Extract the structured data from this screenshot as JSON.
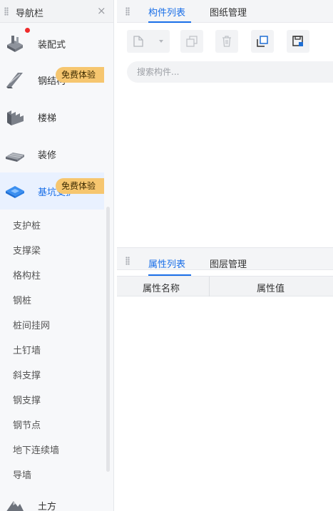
{
  "nav": {
    "title": "导航栏",
    "close": "×",
    "categories": [
      {
        "label": "装配式",
        "icon": "prefab-component-icon",
        "has_dot": true
      },
      {
        "label": "钢结构",
        "icon": "steel-beam-icon",
        "badge": "免费体验"
      },
      {
        "label": "楼梯",
        "icon": "stairs-icon"
      },
      {
        "label": "装修",
        "icon": "decoration-floor-icon"
      },
      {
        "label": "基坑支护",
        "icon": "foundation-pit-icon",
        "badge": "免费体验",
        "active": true
      }
    ],
    "sub_items": [
      "支护桩",
      "支撑梁",
      "格构柱",
      "钢桩",
      "桩间挂网",
      "土钉墙",
      "斜支撑",
      "钢支撑",
      "钢节点",
      "地下连续墙",
      "导墙"
    ],
    "bottom_category": {
      "label": "土方",
      "icon": "earthwork-mountain-icon"
    }
  },
  "top_panel": {
    "tabs": [
      "构件列表",
      "图纸管理"
    ],
    "active_tab": 0,
    "toolbar": [
      "new-component-icon",
      "copy-icon",
      "delete-icon",
      "duplicate-layer-icon",
      "save-template-icon"
    ],
    "search_placeholder": "搜索构件..."
  },
  "bottom_panel": {
    "tabs": [
      "属性列表",
      "图层管理"
    ],
    "active_tab": 0,
    "columns": [
      "属性名称",
      "属性值"
    ]
  },
  "colors": {
    "accent": "#1a6fe8",
    "badge_bg": "#f6c66f",
    "active_bg": "#e9f1ff",
    "dot": "#ef2b2b"
  }
}
